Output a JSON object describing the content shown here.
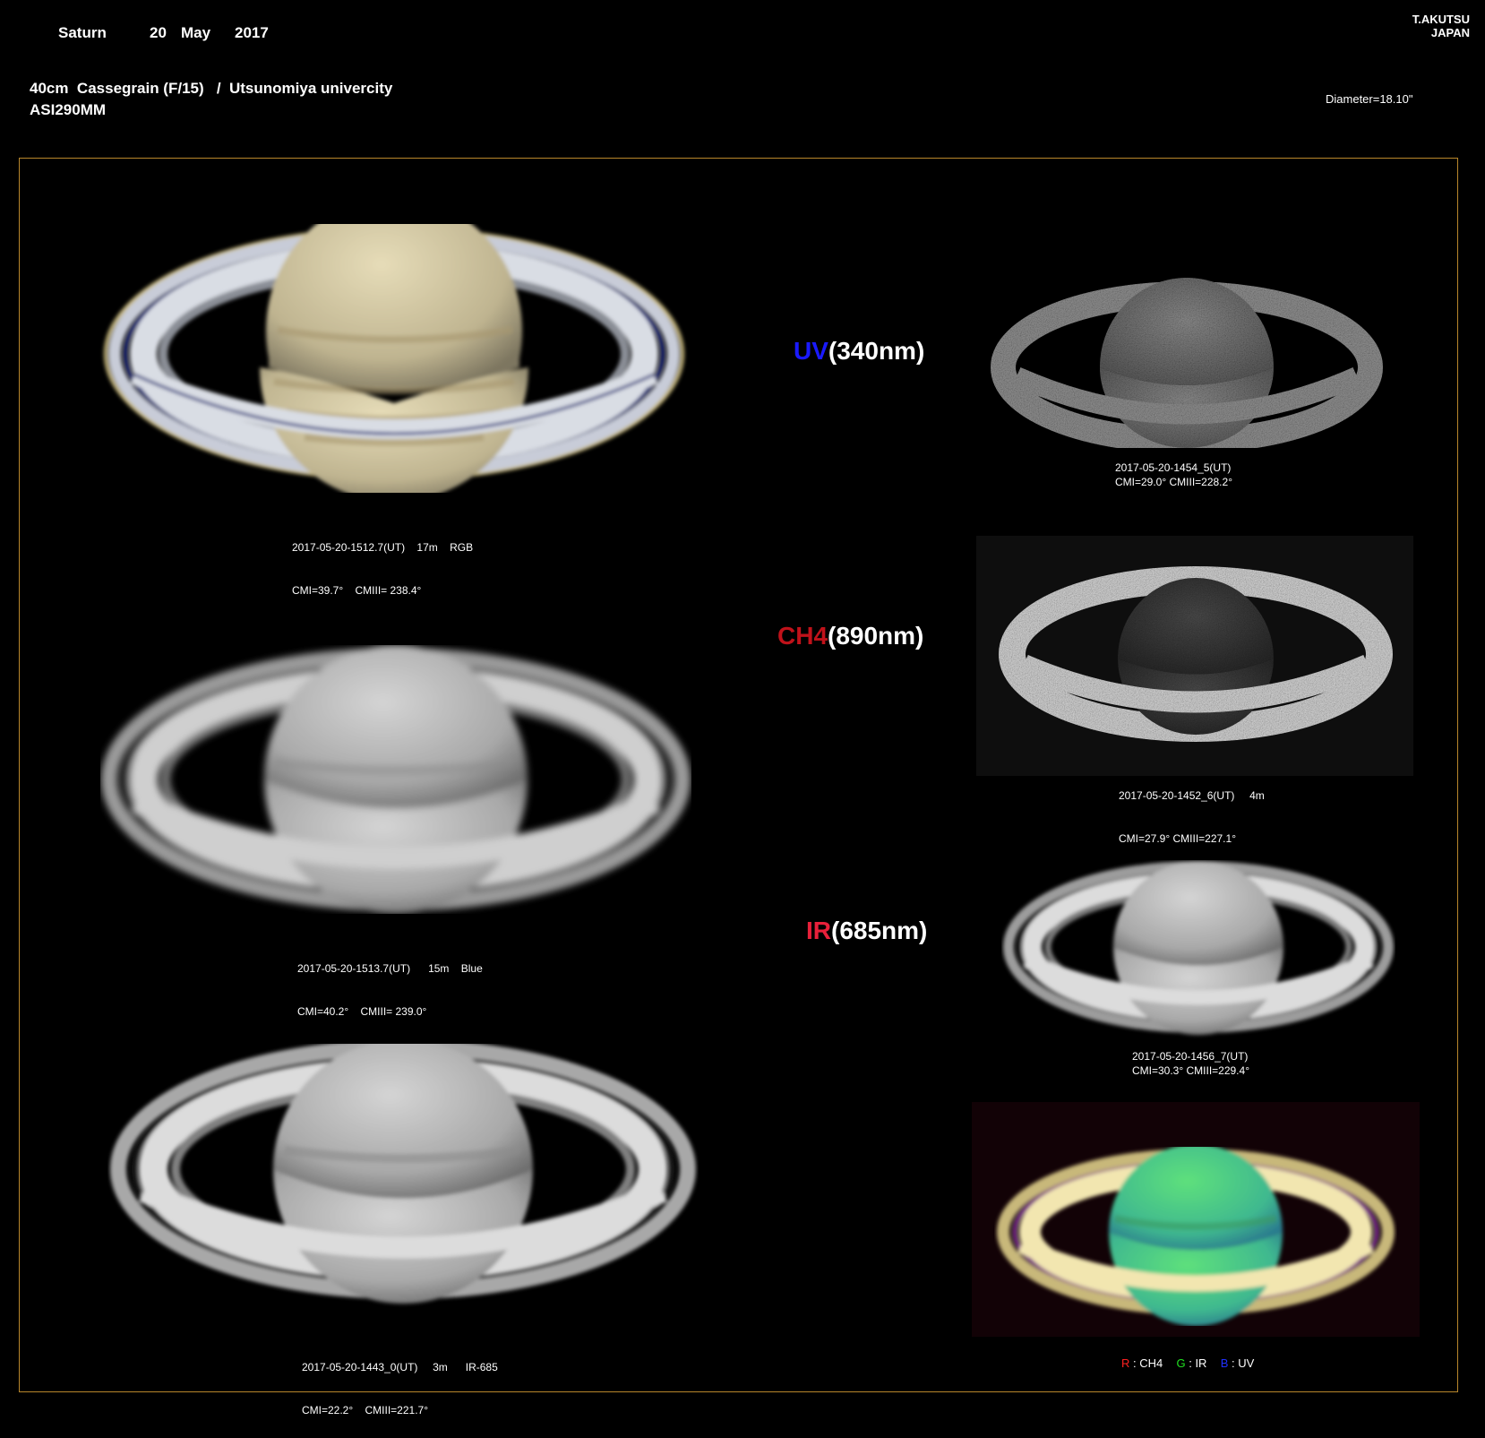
{
  "header": {
    "object": "Saturn",
    "day": "20",
    "month": "May",
    "year": "2017",
    "observer_line1": "T.AKUTSU",
    "observer_line2": "JAPAN",
    "telescope": "40cm  Cassegrain (F/15)   /  Utsunomiya univercity",
    "camera": "ASI290MM",
    "diameter": "Diameter=18.10\""
  },
  "images": {
    "rgb": {
      "line1": "2017-05-20-1512.7(UT)    17m    RGB",
      "line2": "CMI=39.7°    CMIII= 238.4°"
    },
    "blue": {
      "line1": "2017-05-20-1513.7(UT)      15m    Blue",
      "line2": "CMI=40.2°    CMIII= 239.0°"
    },
    "ir685_large": {
      "line1": "2017-05-20-1443_0(UT)     3m      IR-685",
      "line2": "CMI=22.2°    CMIII=221.7°"
    },
    "uv": {
      "label_colored": "UV",
      "label_rest": "(340nm)",
      "line1": "2017-05-20-1454_5(UT)",
      "line2": "CMI=29.0° CMIII=228.2°",
      "color": "#1a1aff"
    },
    "ch4": {
      "label_colored": "CH4",
      "label_rest": "(890nm)",
      "line1": "2017-05-20-1452_6(UT)     4m",
      "line2": "CMI=27.9° CMIII=227.1°",
      "color": "#c0121a"
    },
    "ir": {
      "label_colored": "IR",
      "label_rest": "(685nm)",
      "line1": "2017-05-20-1456_7(UT)",
      "line2": "CMI=30.3° CMIII=229.4°",
      "color": "#e8203a"
    },
    "composite": {
      "r_key": "R",
      "r_val": " : CH4",
      "g_key": "G",
      "g_val": " : IR",
      "b_key": "B",
      "b_val": " : UV",
      "r_color": "#ff2020",
      "g_color": "#20e020",
      "b_color": "#2030ff"
    }
  }
}
